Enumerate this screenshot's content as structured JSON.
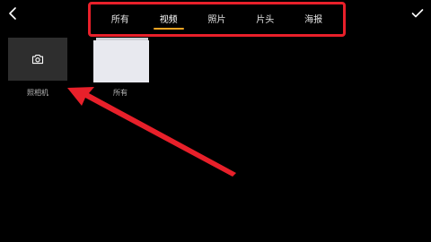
{
  "colors": {
    "background": "#000000",
    "highlight": "#e8202a",
    "tab_underline": "#f5a623",
    "camera_tile": "#2e2e2e"
  },
  "header": {
    "back_icon": "chevron-left-icon",
    "confirm_icon": "checkmark-icon",
    "tabs": [
      {
        "label": "所有",
        "active": false
      },
      {
        "label": "视频",
        "active": true
      },
      {
        "label": "照片",
        "active": false
      },
      {
        "label": "片头",
        "active": false
      },
      {
        "label": "海报",
        "active": false
      }
    ]
  },
  "albums": [
    {
      "label": "照相机",
      "icon": "camera-icon"
    },
    {
      "label": "所有"
    }
  ]
}
